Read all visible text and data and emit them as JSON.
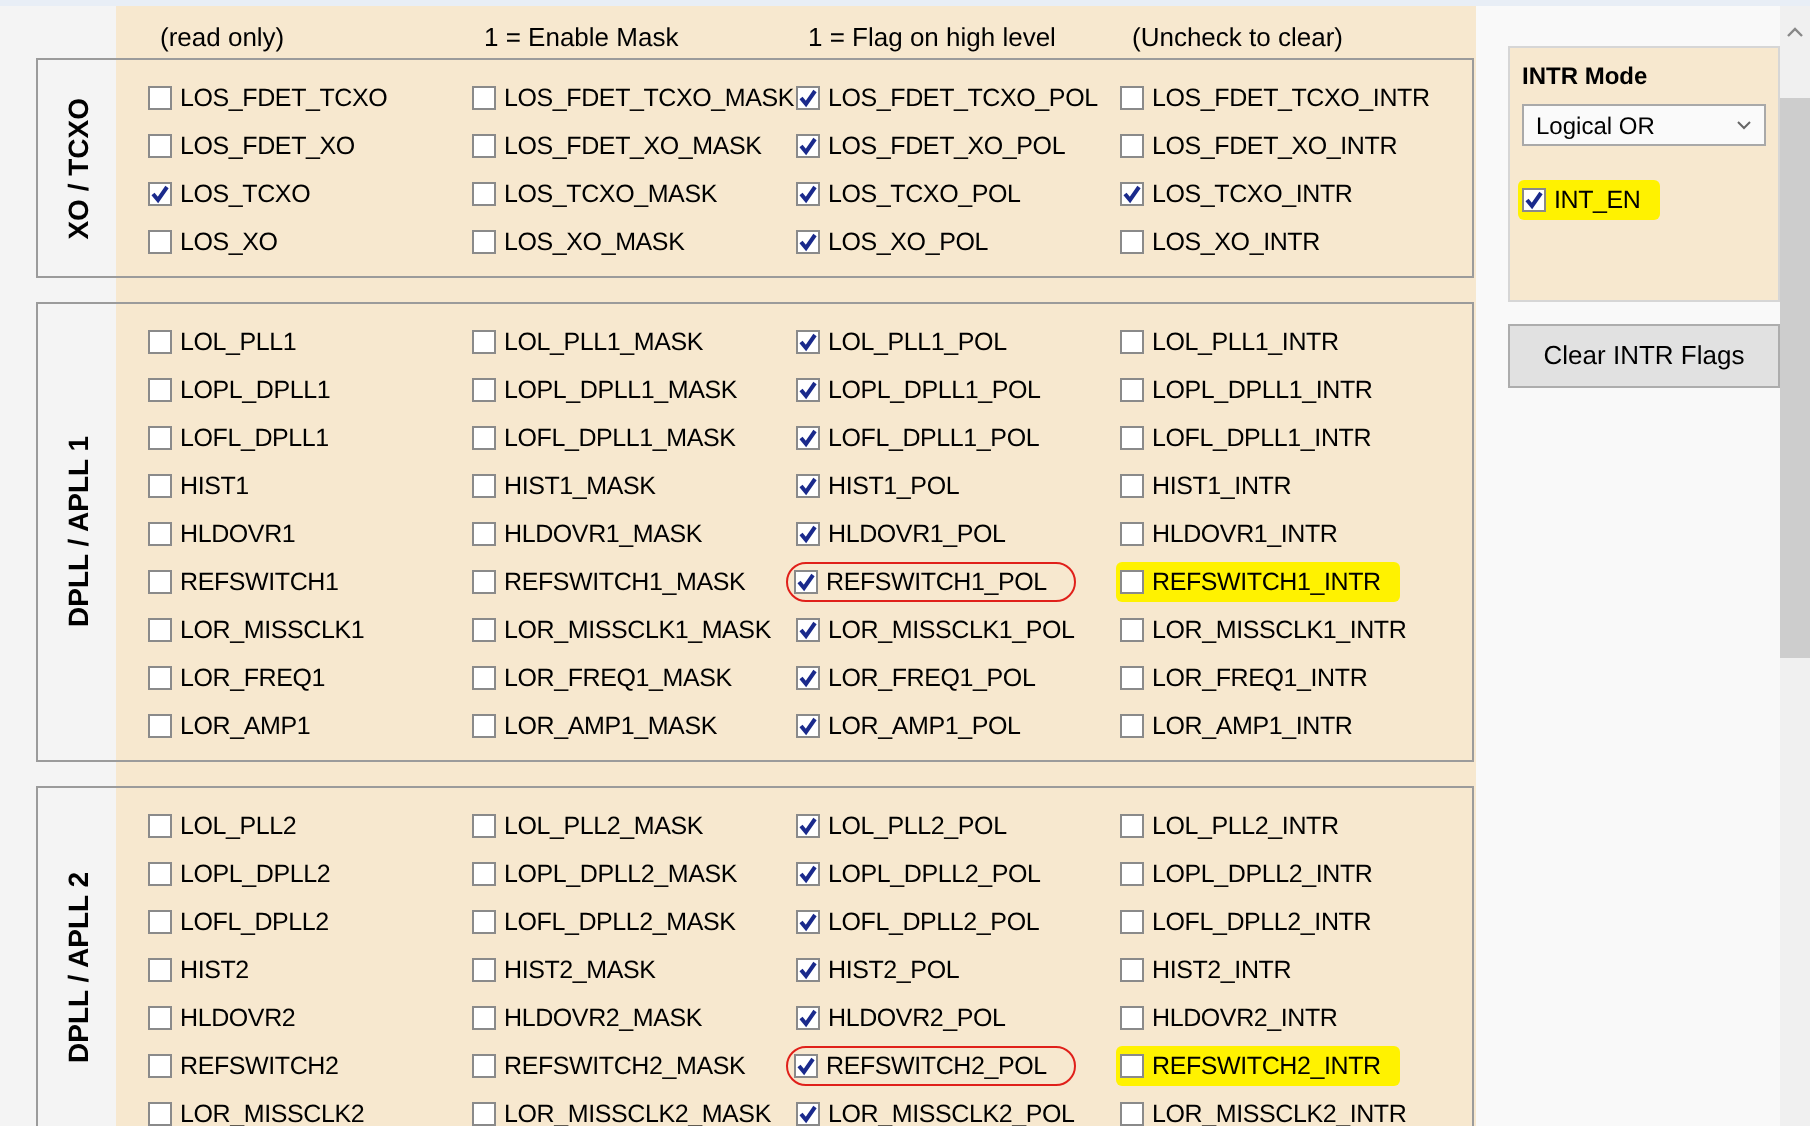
{
  "header_notes": [
    "(read only)",
    "1 = Enable Mask",
    "1 = Flag on high level",
    "(Uncheck to clear)"
  ],
  "groups": [
    {
      "title": "XO / TCXO",
      "rows": [
        [
          {
            "label": "LOS_FDET_TCXO",
            "checked": false,
            "highlighted": false,
            "circled": false
          },
          {
            "label": "LOS_FDET_TCXO_MASK",
            "checked": false,
            "highlighted": false,
            "circled": false
          },
          {
            "label": "LOS_FDET_TCXO_POL",
            "checked": true,
            "highlighted": false,
            "circled": false
          },
          {
            "label": "LOS_FDET_TCXO_INTR",
            "checked": false,
            "highlighted": false,
            "circled": false
          }
        ],
        [
          {
            "label": "LOS_FDET_XO",
            "checked": false,
            "highlighted": false,
            "circled": false
          },
          {
            "label": "LOS_FDET_XO_MASK",
            "checked": false,
            "highlighted": false,
            "circled": false
          },
          {
            "label": "LOS_FDET_XO_POL",
            "checked": true,
            "highlighted": false,
            "circled": false
          },
          {
            "label": "LOS_FDET_XO_INTR",
            "checked": false,
            "highlighted": false,
            "circled": false
          }
        ],
        [
          {
            "label": "LOS_TCXO",
            "checked": true,
            "highlighted": false,
            "circled": false
          },
          {
            "label": "LOS_TCXO_MASK",
            "checked": false,
            "highlighted": false,
            "circled": false
          },
          {
            "label": "LOS_TCXO_POL",
            "checked": true,
            "highlighted": false,
            "circled": false
          },
          {
            "label": "LOS_TCXO_INTR",
            "checked": true,
            "highlighted": false,
            "circled": false
          }
        ],
        [
          {
            "label": "LOS_XO",
            "checked": false,
            "highlighted": false,
            "circled": false
          },
          {
            "label": "LOS_XO_MASK",
            "checked": false,
            "highlighted": false,
            "circled": false
          },
          {
            "label": "LOS_XO_POL",
            "checked": true,
            "highlighted": false,
            "circled": false
          },
          {
            "label": "LOS_XO_INTR",
            "checked": false,
            "highlighted": false,
            "circled": false
          }
        ]
      ]
    },
    {
      "title": "DPLL / APLL 1",
      "rows": [
        [
          {
            "label": "LOL_PLL1",
            "checked": false,
            "highlighted": false,
            "circled": false
          },
          {
            "label": "LOL_PLL1_MASK",
            "checked": false,
            "highlighted": false,
            "circled": false
          },
          {
            "label": "LOL_PLL1_POL",
            "checked": true,
            "highlighted": false,
            "circled": false
          },
          {
            "label": "LOL_PLL1_INTR",
            "checked": false,
            "highlighted": false,
            "circled": false
          }
        ],
        [
          {
            "label": "LOPL_DPLL1",
            "checked": false,
            "highlighted": false,
            "circled": false
          },
          {
            "label": "LOPL_DPLL1_MASK",
            "checked": false,
            "highlighted": false,
            "circled": false
          },
          {
            "label": "LOPL_DPLL1_POL",
            "checked": true,
            "highlighted": false,
            "circled": false
          },
          {
            "label": "LOPL_DPLL1_INTR",
            "checked": false,
            "highlighted": false,
            "circled": false
          }
        ],
        [
          {
            "label": "LOFL_DPLL1",
            "checked": false,
            "highlighted": false,
            "circled": false
          },
          {
            "label": "LOFL_DPLL1_MASK",
            "checked": false,
            "highlighted": false,
            "circled": false
          },
          {
            "label": "LOFL_DPLL1_POL",
            "checked": true,
            "highlighted": false,
            "circled": false
          },
          {
            "label": "LOFL_DPLL1_INTR",
            "checked": false,
            "highlighted": false,
            "circled": false
          }
        ],
        [
          {
            "label": "HIST1",
            "checked": false,
            "highlighted": false,
            "circled": false
          },
          {
            "label": "HIST1_MASK",
            "checked": false,
            "highlighted": false,
            "circled": false
          },
          {
            "label": "HIST1_POL",
            "checked": true,
            "highlighted": false,
            "circled": false
          },
          {
            "label": "HIST1_INTR",
            "checked": false,
            "highlighted": false,
            "circled": false
          }
        ],
        [
          {
            "label": "HLDOVR1",
            "checked": false,
            "highlighted": false,
            "circled": false
          },
          {
            "label": "HLDOVR1_MASK",
            "checked": false,
            "highlighted": false,
            "circled": false
          },
          {
            "label": "HLDOVR1_POL",
            "checked": true,
            "highlighted": false,
            "circled": false
          },
          {
            "label": "HLDOVR1_INTR",
            "checked": false,
            "highlighted": false,
            "circled": false
          }
        ],
        [
          {
            "label": "REFSWITCH1",
            "checked": false,
            "highlighted": false,
            "circled": false
          },
          {
            "label": "REFSWITCH1_MASK",
            "checked": false,
            "highlighted": false,
            "circled": false
          },
          {
            "label": "REFSWITCH1_POL",
            "checked": true,
            "highlighted": false,
            "circled": true
          },
          {
            "label": "REFSWITCH1_INTR",
            "checked": false,
            "highlighted": true,
            "circled": false
          }
        ],
        [
          {
            "label": "LOR_MISSCLK1",
            "checked": false,
            "highlighted": false,
            "circled": false
          },
          {
            "label": "LOR_MISSCLK1_MASK",
            "checked": false,
            "highlighted": false,
            "circled": false
          },
          {
            "label": "LOR_MISSCLK1_POL",
            "checked": true,
            "highlighted": false,
            "circled": false
          },
          {
            "label": "LOR_MISSCLK1_INTR",
            "checked": false,
            "highlighted": false,
            "circled": false
          }
        ],
        [
          {
            "label": "LOR_FREQ1",
            "checked": false,
            "highlighted": false,
            "circled": false
          },
          {
            "label": "LOR_FREQ1_MASK",
            "checked": false,
            "highlighted": false,
            "circled": false
          },
          {
            "label": "LOR_FREQ1_POL",
            "checked": true,
            "highlighted": false,
            "circled": false
          },
          {
            "label": "LOR_FREQ1_INTR",
            "checked": false,
            "highlighted": false,
            "circled": false
          }
        ],
        [
          {
            "label": "LOR_AMP1",
            "checked": false,
            "highlighted": false,
            "circled": false
          },
          {
            "label": "LOR_AMP1_MASK",
            "checked": false,
            "highlighted": false,
            "circled": false
          },
          {
            "label": "LOR_AMP1_POL",
            "checked": true,
            "highlighted": false,
            "circled": false
          },
          {
            "label": "LOR_AMP1_INTR",
            "checked": false,
            "highlighted": false,
            "circled": false
          }
        ]
      ]
    },
    {
      "title": "DPLL / APLL 2",
      "rows": [
        [
          {
            "label": "LOL_PLL2",
            "checked": false,
            "highlighted": false,
            "circled": false
          },
          {
            "label": "LOL_PLL2_MASK",
            "checked": false,
            "highlighted": false,
            "circled": false
          },
          {
            "label": "LOL_PLL2_POL",
            "checked": true,
            "highlighted": false,
            "circled": false
          },
          {
            "label": "LOL_PLL2_INTR",
            "checked": false,
            "highlighted": false,
            "circled": false
          }
        ],
        [
          {
            "label": "LOPL_DPLL2",
            "checked": false,
            "highlighted": false,
            "circled": false
          },
          {
            "label": "LOPL_DPLL2_MASK",
            "checked": false,
            "highlighted": false,
            "circled": false
          },
          {
            "label": "LOPL_DPLL2_POL",
            "checked": true,
            "highlighted": false,
            "circled": false
          },
          {
            "label": "LOPL_DPLL2_INTR",
            "checked": false,
            "highlighted": false,
            "circled": false
          }
        ],
        [
          {
            "label": "LOFL_DPLL2",
            "checked": false,
            "highlighted": false,
            "circled": false
          },
          {
            "label": "LOFL_DPLL2_MASK",
            "checked": false,
            "highlighted": false,
            "circled": false
          },
          {
            "label": "LOFL_DPLL2_POL",
            "checked": true,
            "highlighted": false,
            "circled": false
          },
          {
            "label": "LOFL_DPLL2_INTR",
            "checked": false,
            "highlighted": false,
            "circled": false
          }
        ],
        [
          {
            "label": "HIST2",
            "checked": false,
            "highlighted": false,
            "circled": false
          },
          {
            "label": "HIST2_MASK",
            "checked": false,
            "highlighted": false,
            "circled": false
          },
          {
            "label": "HIST2_POL",
            "checked": true,
            "highlighted": false,
            "circled": false
          },
          {
            "label": "HIST2_INTR",
            "checked": false,
            "highlighted": false,
            "circled": false
          }
        ],
        [
          {
            "label": "HLDOVR2",
            "checked": false,
            "highlighted": false,
            "circled": false
          },
          {
            "label": "HLDOVR2_MASK",
            "checked": false,
            "highlighted": false,
            "circled": false
          },
          {
            "label": "HLDOVR2_POL",
            "checked": true,
            "highlighted": false,
            "circled": false
          },
          {
            "label": "HLDOVR2_INTR",
            "checked": false,
            "highlighted": false,
            "circled": false
          }
        ],
        [
          {
            "label": "REFSWITCH2",
            "checked": false,
            "highlighted": false,
            "circled": false
          },
          {
            "label": "REFSWITCH2_MASK",
            "checked": false,
            "highlighted": false,
            "circled": false
          },
          {
            "label": "REFSWITCH2_POL",
            "checked": true,
            "highlighted": false,
            "circled": true
          },
          {
            "label": "REFSWITCH2_INTR",
            "checked": false,
            "highlighted": true,
            "circled": false
          }
        ],
        [
          {
            "label": "LOR_MISSCLK2",
            "checked": false,
            "highlighted": false,
            "circled": false
          },
          {
            "label": "LOR_MISSCLK2_MASK",
            "checked": false,
            "highlighted": false,
            "circled": false
          },
          {
            "label": "LOR_MISSCLK2_POL",
            "checked": true,
            "highlighted": false,
            "circled": false
          },
          {
            "label": "LOR_MISSCLK2_INTR",
            "checked": false,
            "highlighted": false,
            "circled": false
          }
        ]
      ]
    }
  ],
  "intr_panel": {
    "title": "INTR Mode",
    "mode": "Logical OR",
    "int_en": {
      "label": "INT_EN",
      "checked": true,
      "highlighted": true,
      "circled": false
    },
    "clear_button": "Clear INTR Flags"
  }
}
